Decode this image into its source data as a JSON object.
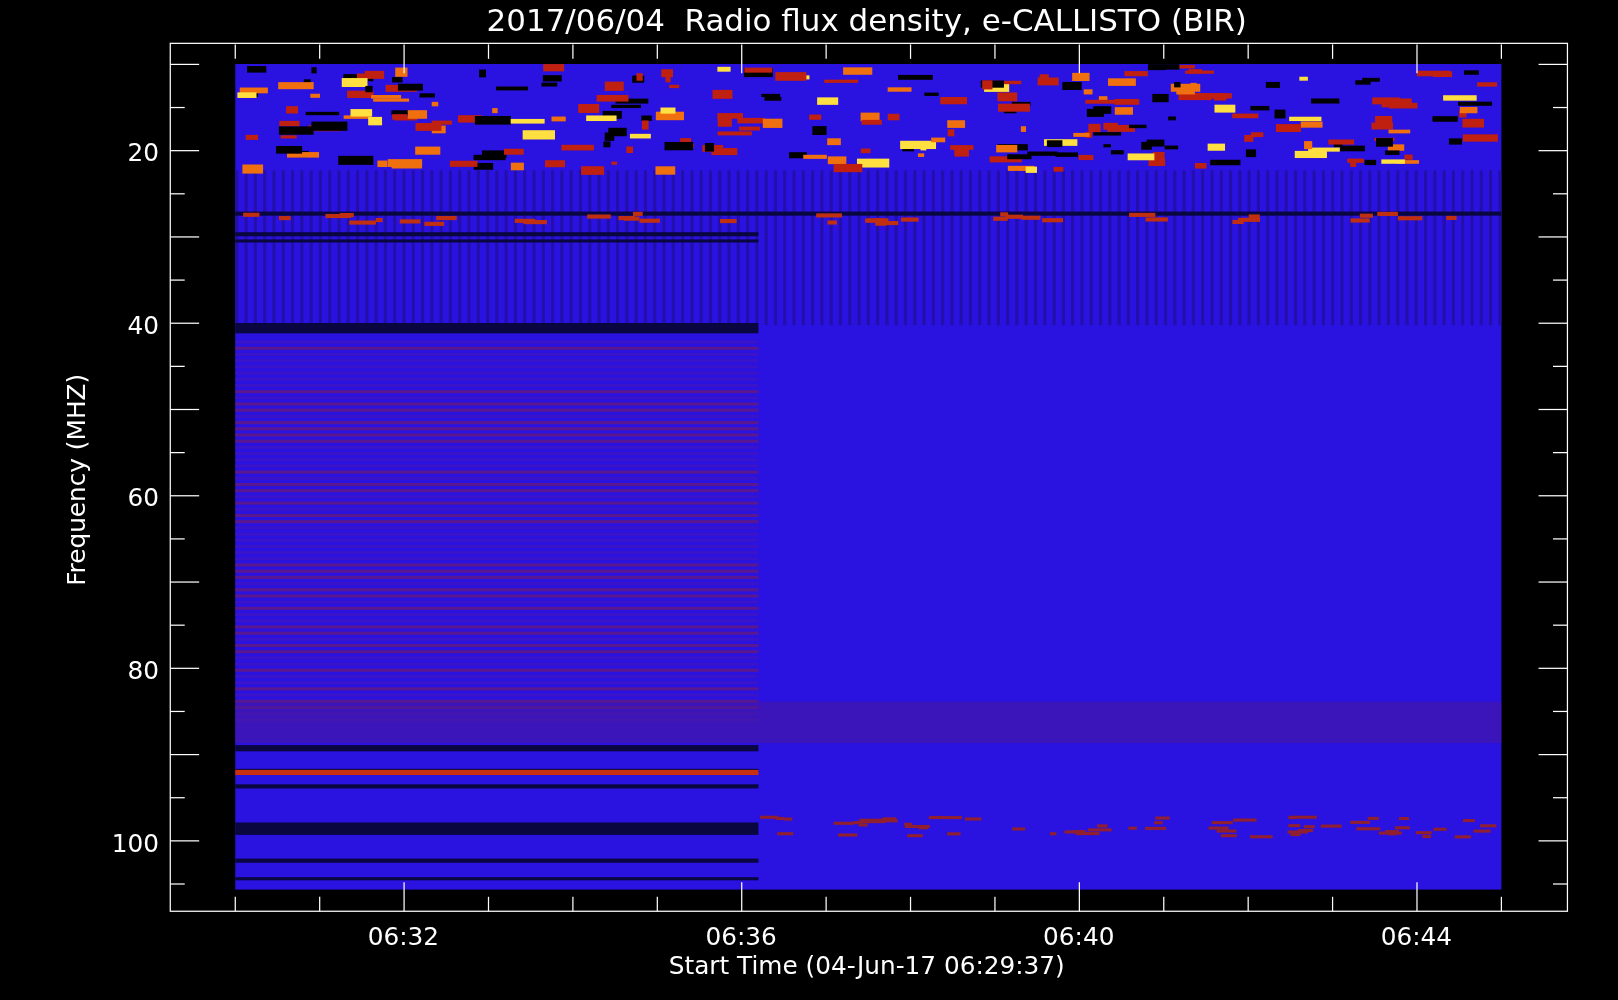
{
  "title": "2017/06/04  Radio flux density, e-CALLISTO (BIR)",
  "y_axis": {
    "label": "Frequency (MHZ)",
    "ticks": [
      "20",
      "40",
      "60",
      "80",
      "100"
    ]
  },
  "x_axis": {
    "label": "Start Time (04-Jun-17 06:29:37)",
    "ticks": [
      "06:32",
      "06:36",
      "06:40",
      "06:44"
    ]
  }
}
